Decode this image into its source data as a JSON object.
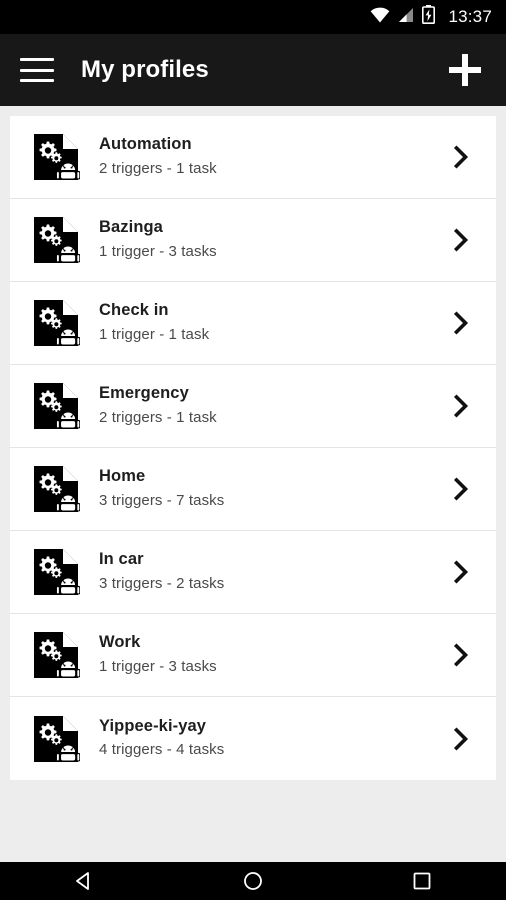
{
  "statusbar": {
    "time": "13:37",
    "icons": [
      "wifi-icon",
      "signal-icon",
      "battery-charging-icon"
    ]
  },
  "toolbar": {
    "menu_icon": "hamburger-menu-icon",
    "title": "My profiles",
    "add_icon": "plus-icon"
  },
  "colors": {
    "statusbar_bg": "#000000",
    "toolbar_bg": "#181818",
    "page_bg": "#ededed",
    "card_bg": "#ffffff",
    "title_text": "#1e1e1e",
    "subtitle_text": "#4a4a4a",
    "divider": "#e4e4e4",
    "accent": "#ffffff"
  },
  "list": {
    "item_icon": "profile-document-gear-android-icon",
    "chevron_icon": "chevron-right-icon",
    "items": [
      {
        "title": "Automation",
        "subtitle": "2 triggers - 1 task"
      },
      {
        "title": "Bazinga",
        "subtitle": "1 trigger - 3 tasks"
      },
      {
        "title": "Check in",
        "subtitle": "1 trigger - 1 task"
      },
      {
        "title": "Emergency",
        "subtitle": "2 triggers - 1 task"
      },
      {
        "title": "Home",
        "subtitle": "3 triggers - 7 tasks"
      },
      {
        "title": "In car",
        "subtitle": "3 triggers - 2 tasks"
      },
      {
        "title": "Work",
        "subtitle": "1 trigger - 3 tasks"
      },
      {
        "title": "Yippee-ki-yay",
        "subtitle": "4 triggers - 4 tasks"
      }
    ]
  },
  "navbar": {
    "back_label": "back-icon",
    "home_label": "home-icon",
    "recents_label": "recents-icon"
  }
}
